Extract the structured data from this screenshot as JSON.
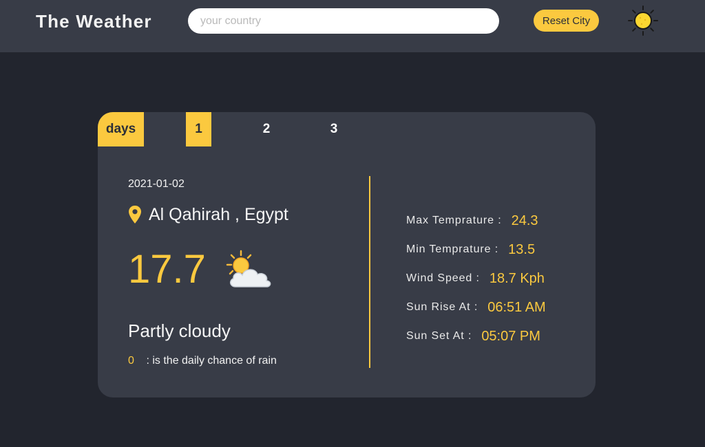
{
  "header": {
    "title": "The Weather",
    "search": {
      "placeholder": "your country",
      "value": ""
    },
    "reset_label": "Reset City",
    "theme_icon": "sun-icon"
  },
  "tabs": [
    "days",
    "1",
    "2",
    "3"
  ],
  "active_tabs": [
    "days",
    "1"
  ],
  "forecast": {
    "date": "2021-01-02",
    "location": "Al Qahirah , Egypt",
    "temperature": "17.7",
    "condition_icon": "partly-cloudy-icon",
    "condition": "Partly cloudy",
    "rain_chance": "0",
    "rain_text": ": is the daily chance of rain"
  },
  "stats": [
    {
      "label": "Max Temprature :",
      "value": "24.3"
    },
    {
      "label": "Min Temprature :",
      "value": "13.5"
    },
    {
      "label": "Wind Speed :",
      "value": "18.7 Kph"
    },
    {
      "label": "Sun Rise At :",
      "value": "06:51 AM"
    },
    {
      "label": "Sun Set At :",
      "value": "05:07 PM"
    }
  ],
  "colors": {
    "accent": "#fbc93f",
    "background": "#22252e",
    "panel": "#383c47"
  }
}
